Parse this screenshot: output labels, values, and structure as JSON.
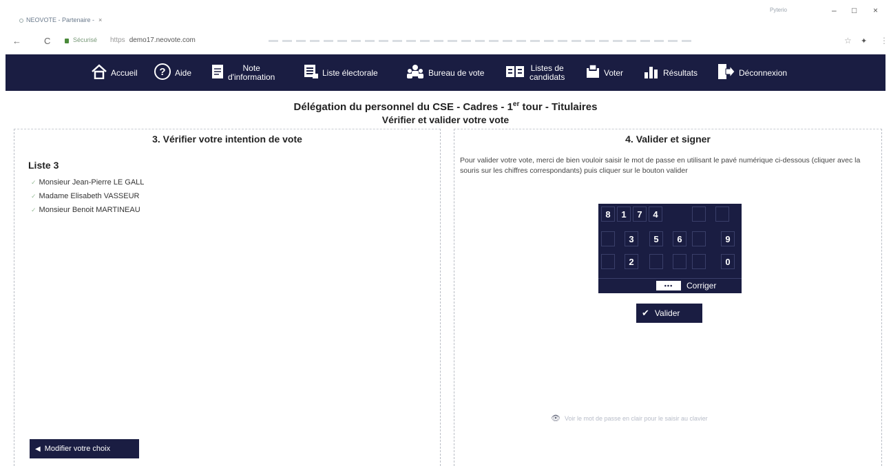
{
  "browser": {
    "tab_title": "NEOVOTE - Partenaire -",
    "tab_close": "×",
    "profile": "Pyterio",
    "win_min": "–",
    "win_max": "□",
    "win_close": "×",
    "back": "←",
    "reload": "C",
    "secure_label": "Sécurisé",
    "url_proto": "https",
    "url": "demo17.neovote.com",
    "star": "☆",
    "ext": "✦",
    "menu": "⋮"
  },
  "nav": {
    "accueil": "Accueil",
    "aide": "Aide",
    "note_l1": "Note",
    "note_l2": "d'information",
    "liste_electorale": "Liste électorale",
    "bureau": "Bureau de vote",
    "listes_l1": "Listes de",
    "listes_l2": "candidats",
    "voter": "Voter",
    "resultats": "Résultats",
    "deconnexion": "Déconnexion"
  },
  "header": {
    "title_pre": "Délégation du personnel du CSE - Cadres - 1",
    "title_sup": "er",
    "title_post": " tour - Titulaires",
    "subtitle": "Vérifier et valider votre vote"
  },
  "left": {
    "title": "3. Vérifier votre intention de vote",
    "liste": "Liste 3",
    "candidates": [
      "Monsieur Jean-Pierre LE GALL",
      "Madame Elisabeth VASSEUR",
      "Monsieur Benoit MARTINEAU"
    ],
    "modify_label": "Modifier votre choix"
  },
  "right": {
    "title": "4. Valider et signer",
    "instructions": "Pour valider votre vote, merci de bien vouloir saisir le mot de passe en utilisant le pavé numérique ci-dessous (cliquer avec la souris sur les chiffres correspondants) puis cliquer sur le bouton valider",
    "keypad": {
      "row1": [
        "8",
        "1",
        "7",
        "4",
        "",
        ""
      ],
      "row2": [
        "",
        "3",
        "5",
        "6",
        "",
        "9"
      ],
      "row3": [
        "",
        "2",
        "",
        "",
        "",
        "0"
      ]
    },
    "password_mask": "•••",
    "corriger": "Corriger",
    "valider": "Valider",
    "faint_link": "Voir le mot de passe en clair pour le saisir au clavier"
  },
  "colors": {
    "navy": "#1a1d42"
  }
}
